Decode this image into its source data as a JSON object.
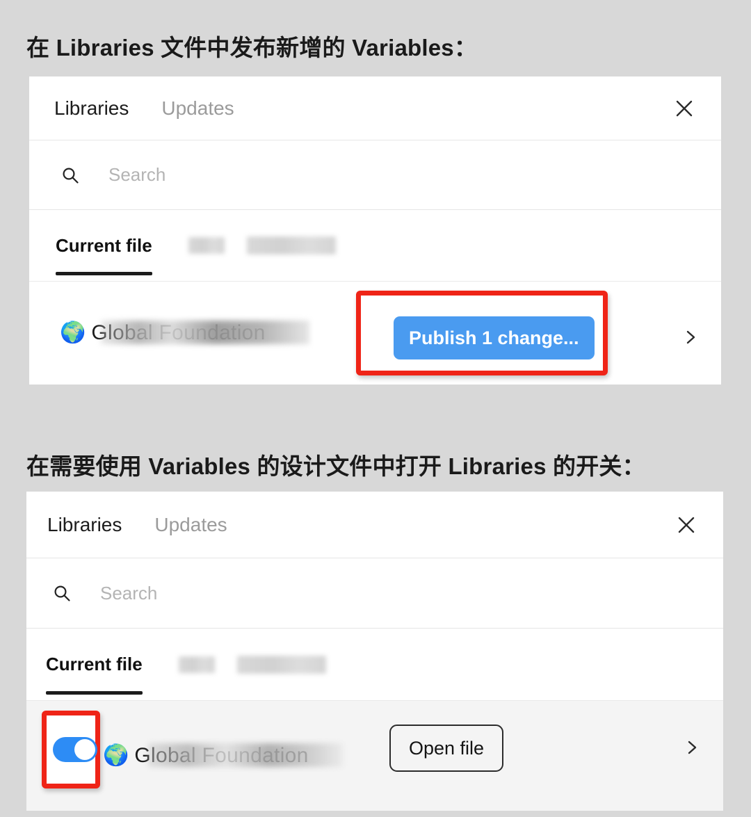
{
  "page": {
    "background_color": "#d8d8d8",
    "accent_blue": "#4a9bf0",
    "annotation_red": "#ef2417",
    "toggle_on_color": "#2d8cf5"
  },
  "sections": [
    {
      "heading": "在 Libraries 文件中发布新增的 Variables：",
      "panel": {
        "tabs": [
          {
            "label": "Libraries",
            "active": true
          },
          {
            "label": "Updates",
            "active": false
          }
        ],
        "close_icon": "close-icon",
        "search": {
          "icon": "search-icon",
          "placeholder": "Search"
        },
        "filters": [
          {
            "label": "Current file",
            "active": true
          },
          {
            "label": "",
            "redacted": true
          },
          {
            "label": "",
            "redacted": true
          }
        ],
        "library_row": {
          "icon": "globe-icon",
          "name": "Global Foundation",
          "name_blurred": true,
          "toggle": null,
          "action_button": "Publish 1 change...",
          "action_button_style": "primary",
          "chevron_icon": "chevron-right-icon",
          "highlighted": true
        }
      }
    },
    {
      "heading": "在需要使用 Variables 的设计文件中打开 Libraries 的开关：",
      "panel": {
        "tabs": [
          {
            "label": "Libraries",
            "active": true
          },
          {
            "label": "Updates",
            "active": false
          }
        ],
        "close_icon": "close-icon",
        "search": {
          "icon": "search-icon",
          "placeholder": "Search"
        },
        "filters": [
          {
            "label": "Current file",
            "active": true
          },
          {
            "label": "",
            "redacted": true
          },
          {
            "label": "",
            "redacted": true
          }
        ],
        "library_row": {
          "icon": "globe-icon",
          "name": "Global Foundation",
          "name_blurred": true,
          "toggle": {
            "state": "on",
            "highlighted": true
          },
          "action_button": "Open file",
          "action_button_style": "outline",
          "chevron_icon": "chevron-right-icon",
          "highlighted": false
        }
      }
    }
  ]
}
